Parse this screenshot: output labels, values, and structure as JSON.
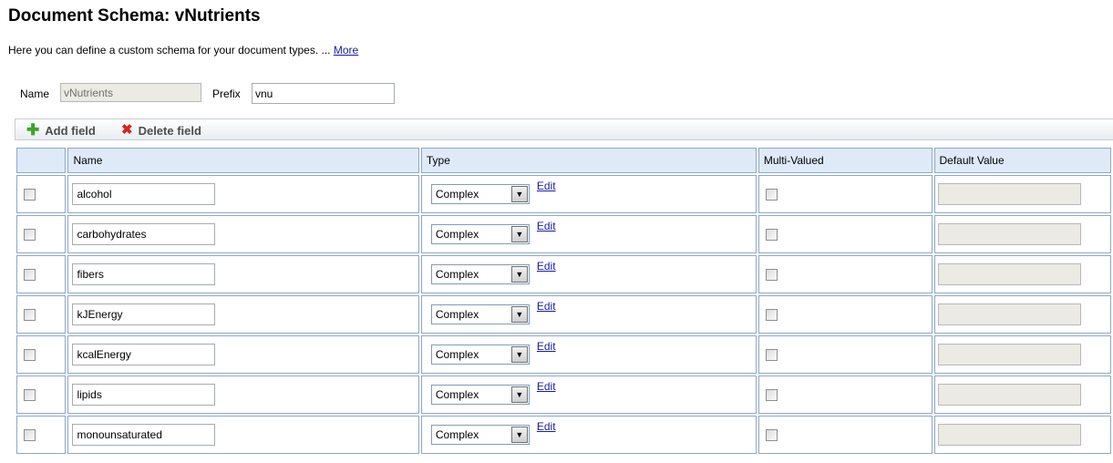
{
  "page": {
    "title": "Document Schema: vNutrients",
    "description": "Here you can define a custom schema for your document types. ... ",
    "more_link": "More"
  },
  "form": {
    "name_label": "Name",
    "name_value": "vNutrients",
    "prefix_label": "Prefix",
    "prefix_value": "vnu"
  },
  "toolbar": {
    "add_label": "Add field",
    "delete_label": "Delete field"
  },
  "table": {
    "headers": [
      "",
      "Name",
      "Type",
      "Multi-Valued",
      "Default Value"
    ],
    "rows": [
      {
        "name": "alcohol",
        "type": "Complex",
        "edit": "Edit"
      },
      {
        "name": "carbohydrates",
        "type": "Complex",
        "edit": "Edit"
      },
      {
        "name": "fibers",
        "type": "Complex",
        "edit": "Edit"
      },
      {
        "name": "kJEnergy",
        "type": "Complex",
        "edit": "Edit"
      },
      {
        "name": "kcalEnergy",
        "type": "Complex",
        "edit": "Edit"
      },
      {
        "name": "lipids",
        "type": "Complex",
        "edit": "Edit"
      },
      {
        "name": "monounsaturated",
        "type": "Complex",
        "edit": "Edit"
      }
    ]
  },
  "icons": {
    "add": "plus-icon",
    "delete": "x-icon",
    "dropdown": "chevron-down-icon"
  },
  "colors": {
    "header_bg": "#dfeaf8",
    "cell_border": "#8fa8c6",
    "link": "#1a1aa6",
    "add_icon": "#3aa52a",
    "delete_icon": "#d8251a"
  }
}
